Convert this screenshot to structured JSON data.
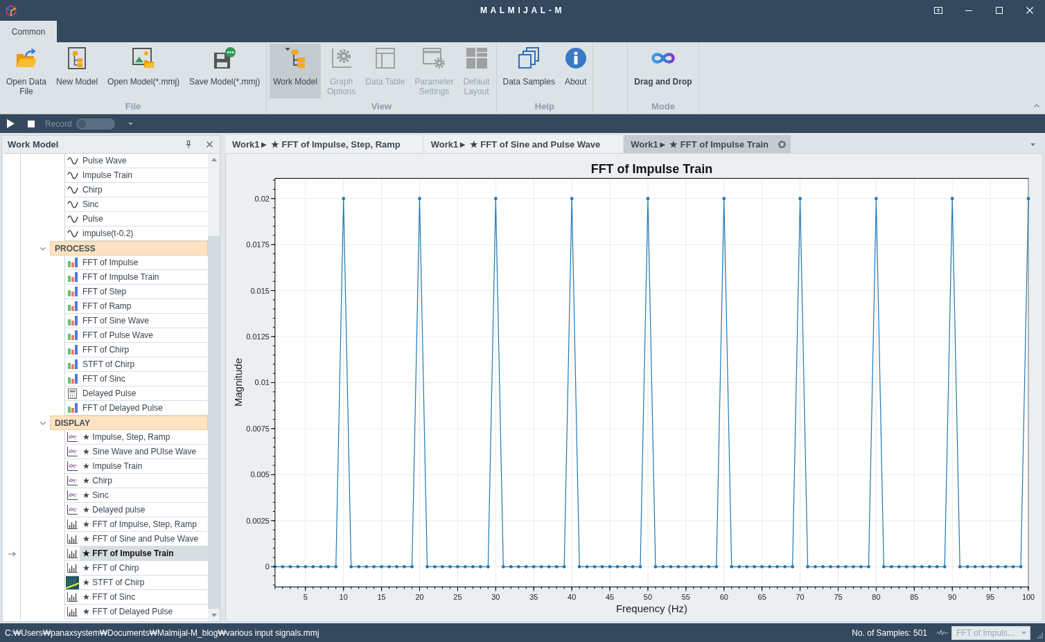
{
  "window": {
    "title": "MALMIJAL-M"
  },
  "ribbon": {
    "tabs": [
      {
        "label": "Common",
        "selected": true
      }
    ],
    "groups": [
      {
        "label": "File",
        "buttons": [
          {
            "kind": "open-data",
            "label": "Open Data\nFile",
            "disabled": false,
            "selected": false,
            "active": false
          },
          {
            "kind": "new-model",
            "label": "New Model",
            "disabled": false,
            "selected": false,
            "active": false
          },
          {
            "kind": "open-model",
            "label": "Open Model(*.mmj)",
            "disabled": false,
            "selected": false,
            "active": false
          },
          {
            "kind": "save-model",
            "label": "Save Model(*.mmj)",
            "disabled": false,
            "selected": false,
            "active": false
          }
        ]
      },
      {
        "label": "View",
        "buttons": [
          {
            "kind": "work-model",
            "label": "Work Model",
            "disabled": false,
            "selected": true,
            "active": false
          },
          {
            "kind": "graph-options",
            "label": "Graph\nOptions",
            "disabled": true,
            "selected": false,
            "active": false
          },
          {
            "kind": "data-table",
            "label": "Data Table",
            "disabled": true,
            "selected": false,
            "active": false
          },
          {
            "kind": "parameter-settings",
            "label": "Parameter\nSettings",
            "disabled": true,
            "selected": false,
            "active": false
          },
          {
            "kind": "default-layout",
            "label": "Default\nLayout",
            "disabled": true,
            "selected": false,
            "active": false
          }
        ]
      },
      {
        "label": "Help",
        "buttons": [
          {
            "kind": "data-samples",
            "label": "Data Samples",
            "disabled": false,
            "selected": false,
            "active": false
          },
          {
            "kind": "about",
            "label": "About",
            "disabled": false,
            "selected": false,
            "active": false
          }
        ]
      },
      {
        "label": "Mode",
        "buttons": [
          {
            "kind": "drag-drop",
            "label": "Drag and Drop",
            "disabled": false,
            "selected": false,
            "active": true
          }
        ]
      }
    ]
  },
  "toolbar": {
    "record": {
      "label": "Record",
      "on": false
    }
  },
  "work_model": {
    "title": "Work Model",
    "tree": [
      {
        "children": [
          {
            "kind": "signal",
            "label": "Pulse Wave",
            "selected": false
          },
          {
            "kind": "signal",
            "label": "Impulse Train",
            "selected": false
          },
          {
            "kind": "signal",
            "label": "Chirp",
            "selected": false
          },
          {
            "kind": "signal",
            "label": "Sinc",
            "selected": false
          },
          {
            "kind": "signal",
            "label": "Pulse",
            "selected": false
          },
          {
            "kind": "signal",
            "label": "impulse(t-0.2)",
            "selected": false
          }
        ]
      },
      {
        "label": "PROCESS",
        "expanded": true,
        "children": [
          {
            "kind": "fft",
            "label": "FFT of Impulse",
            "selected": false
          },
          {
            "kind": "fft",
            "label": "FFT of Impulse Train",
            "selected": false
          },
          {
            "kind": "fft",
            "label": "FFT of Step",
            "selected": false
          },
          {
            "kind": "fft",
            "label": "FFT of Ramp",
            "selected": false
          },
          {
            "kind": "fft",
            "label": "FFT of Sine Wave",
            "selected": false
          },
          {
            "kind": "fft",
            "label": "FFT of Pulse Wave",
            "selected": false
          },
          {
            "kind": "fft",
            "label": "FFT of Chirp",
            "selected": false
          },
          {
            "kind": "fft",
            "label": "STFT of Chirp",
            "selected": false
          },
          {
            "kind": "fft",
            "label": "FFT of Sinc",
            "selected": false
          },
          {
            "kind": "calc",
            "label": "Delayed Pulse",
            "selected": false
          },
          {
            "kind": "fft",
            "label": "FFT of Delayed Pulse",
            "selected": false
          }
        ]
      },
      {
        "label": "DISPLAY",
        "expanded": true,
        "children": [
          {
            "kind": "plot",
            "label": "★ Impulse, Step, Ramp",
            "selected": false
          },
          {
            "kind": "plot",
            "label": "★ Sine Wave and PUlse Wave",
            "selected": false
          },
          {
            "kind": "plot",
            "label": "★ Impulse Train",
            "selected": false
          },
          {
            "kind": "plot",
            "label": "★ Chirp",
            "selected": false
          },
          {
            "kind": "plot",
            "label": "★ Sinc",
            "selected": false
          },
          {
            "kind": "plot",
            "label": "★ Delayed pulse",
            "selected": false
          },
          {
            "kind": "spectrum",
            "label": "★ FFT of Impulse, Step, Ramp",
            "selected": false
          },
          {
            "kind": "spectrum",
            "label": "★ FFT of Sine and Pulse Wave",
            "selected": false
          },
          {
            "kind": "spectrum",
            "label": "★ FFT of Impulse Train",
            "selected": true
          },
          {
            "kind": "spectrum",
            "label": "★ FFT of Chirp",
            "selected": false
          },
          {
            "kind": "spectrogram",
            "label": "★ STFT of Chirp",
            "selected": false
          },
          {
            "kind": "spectrum",
            "label": "★ FFT of Sinc",
            "selected": false
          },
          {
            "kind": "spectrum",
            "label": "★ FFT of Delayed Pulse",
            "selected": false
          }
        ]
      }
    ]
  },
  "tabs": [
    {
      "label": "Work1► ★ FFT of Impulse, Step, Ramp",
      "selected": false
    },
    {
      "label": "Work1► ★ FFT of Sine and Pulse Wave",
      "selected": false
    },
    {
      "label": "Work1► ★ FFT of Impulse Train",
      "selected": true
    }
  ],
  "chart": {
    "chart_data": {
      "type": "line",
      "title": "FFT of Impulse Train",
      "xlabel": "Frequency (Hz)",
      "ylabel": "Magnitude",
      "x": [
        1,
        2,
        3,
        4,
        5,
        6,
        7,
        8,
        9,
        10,
        11,
        12,
        13,
        14,
        15,
        16,
        17,
        18,
        19,
        20,
        21,
        22,
        23,
        24,
        25,
        26,
        27,
        28,
        29,
        30,
        31,
        32,
        33,
        34,
        35,
        36,
        37,
        38,
        39,
        40,
        41,
        42,
        43,
        44,
        45,
        46,
        47,
        48,
        49,
        50,
        51,
        52,
        53,
        54,
        55,
        56,
        57,
        58,
        59,
        60,
        61,
        62,
        63,
        64,
        65,
        66,
        67,
        68,
        69,
        70,
        71,
        72,
        73,
        74,
        75,
        76,
        77,
        78,
        79,
        80,
        81,
        82,
        83,
        84,
        85,
        86,
        87,
        88,
        89,
        90,
        91,
        92,
        93,
        94,
        95,
        96,
        97,
        98,
        99,
        100
      ],
      "series": [
        {
          "color": "#1f77b4",
          "values": [
            0,
            0,
            0,
            0,
            0,
            0,
            0,
            0,
            0,
            0.02,
            0,
            0,
            0,
            0,
            0,
            0,
            0,
            0,
            0,
            0.02,
            0,
            0,
            0,
            0,
            0,
            0,
            0,
            0,
            0,
            0.02,
            0,
            0,
            0,
            0,
            0,
            0,
            0,
            0,
            0,
            0.02,
            0,
            0,
            0,
            0,
            0,
            0,
            0,
            0,
            0,
            0.02,
            0,
            0,
            0,
            0,
            0,
            0,
            0,
            0,
            0,
            0.02,
            0,
            0,
            0,
            0,
            0,
            0,
            0,
            0,
            0,
            0.02,
            0,
            0,
            0,
            0,
            0,
            0,
            0,
            0,
            0,
            0.02,
            0,
            0,
            0,
            0,
            0,
            0,
            0,
            0,
            0,
            0.02,
            0,
            0,
            0,
            0,
            0,
            0,
            0,
            0,
            0,
            0.02
          ]
        }
      ],
      "xlim": [
        1,
        100
      ],
      "ylim": [
        -0.0011,
        0.0211
      ],
      "xticks": [
        5,
        10,
        15,
        20,
        25,
        30,
        35,
        40,
        45,
        50,
        55,
        60,
        65,
        70,
        75,
        80,
        85,
        90,
        95,
        100
      ],
      "yticks": [
        0,
        0.0025,
        0.005,
        0.0075,
        0.01,
        0.0125,
        0.015,
        0.0175,
        0.02
      ],
      "grid": true
    }
  },
  "status_bar": {
    "path": "C:₩Users₩panaxsystem₩Documents₩Malmijal-M_blog₩various input signals.mmj",
    "sample_count": "No. of Samples: 501",
    "view_select": {
      "value": "FFT of Impuls...",
      "disabled": true
    }
  }
}
